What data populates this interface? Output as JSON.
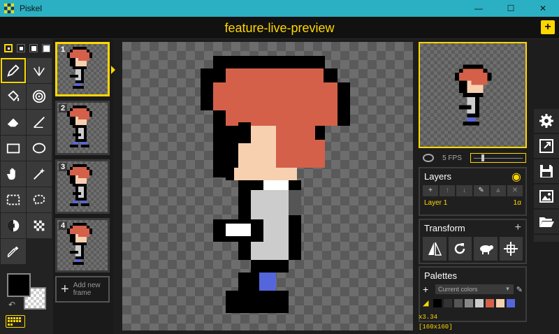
{
  "window": {
    "title": "Piskel",
    "controls": [
      "minimize",
      "maximize",
      "close"
    ]
  },
  "header": {
    "document_title": "feature-live-preview",
    "new_button_label": "+"
  },
  "tools": {
    "pen_sizes": [
      1,
      2,
      3,
      4
    ],
    "selected_pen_size": 1,
    "items": [
      "pen",
      "vertical-mirror-pen",
      "paint-bucket",
      "paint-all-same-color",
      "eraser",
      "stroke",
      "rectangle",
      "circle",
      "move",
      "shape-select",
      "rectangle-select",
      "lasso-select",
      "lighten",
      "dithering",
      "color-picker"
    ],
    "selected": "pen",
    "primary_color": "#000000",
    "secondary_color": "transparent"
  },
  "frames": {
    "items": [
      {
        "number": "1"
      },
      {
        "number": "2"
      },
      {
        "number": "3"
      },
      {
        "number": "4"
      }
    ],
    "selected": 0,
    "add_label_line1": "Add new",
    "add_label_line2": "frame"
  },
  "preview": {
    "fps_label": "5 FPS",
    "fps_value_fraction": 0.2
  },
  "layers": {
    "title": "Layers",
    "buttons": [
      "+",
      "↑",
      "↓",
      "✎",
      "⩓",
      "✕"
    ],
    "items": [
      {
        "name": "Layer 1",
        "opacity": "1α"
      }
    ]
  },
  "transform": {
    "title": "Transform",
    "add_label": "+"
  },
  "palettes": {
    "title": "Palettes",
    "add_label": "+",
    "selected": "Current colors",
    "colors": [
      "#000000",
      "#333333",
      "#555555",
      "#888888",
      "#cccccc",
      "#d4604a",
      "#f7d0b0",
      "#5566dd"
    ],
    "extra_color": "#5566dd"
  },
  "status": {
    "cursor": "x3.34",
    "size": "[160x160]"
  },
  "colors": {
    "accent": "#ffd700",
    "titlebar": "#2bb0c3",
    "hair": "#d4604a",
    "skin": "#f7d0b0",
    "shirt": "#cccccc",
    "pants": "#5566dd"
  }
}
